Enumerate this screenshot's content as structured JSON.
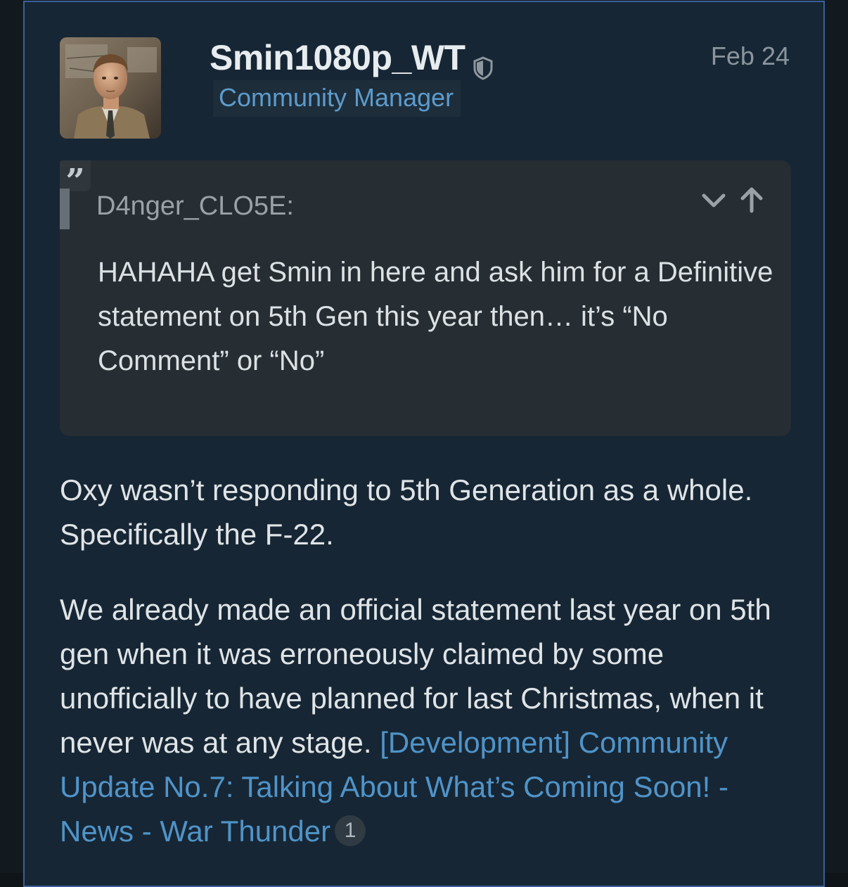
{
  "post": {
    "username": "Smin1080p_WT",
    "user_title": "Community Manager",
    "date": "Feb 24",
    "quote": {
      "author": "D4nger_CLO5E:",
      "text": "HAHAHA get Smin in here and ask him for a Definitive statement on 5th Gen this year then… it’s “No Comment” or “No”"
    },
    "paragraph1": "Oxy wasn’t responding to 5th Generation as a whole. Specifically the F-22.",
    "paragraph2_text": "We already made an official statement last year on 5th gen when it was erroneously claimed by some unofficially to have planned for last Christmas, when it never was at any stage. ",
    "paragraph2_link": "[Development] Community Update No.7: Talking About What’s Coming Soon! - News - War Thunder",
    "link_clicks": "1"
  },
  "colors": {
    "post_background": "#172634",
    "post_border": "#3a5f96",
    "quote_background": "#262d33",
    "link": "#4f94c9",
    "title_badge_text": "#5d9bcc"
  },
  "icons": {
    "moderator": "shield-icon",
    "quote": "quote-icon",
    "expand": "chevron-down-icon",
    "go_to_post": "arrow-up-icon"
  }
}
